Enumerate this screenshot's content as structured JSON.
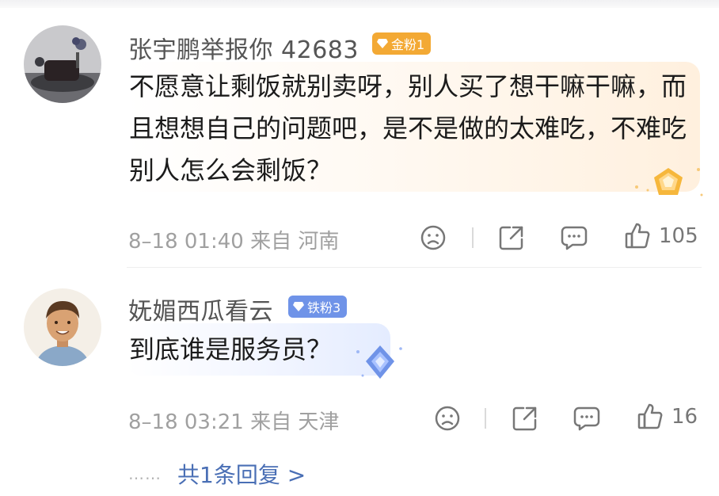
{
  "comments": [
    {
      "username": "张宇鹏举报你 42683",
      "badge": "金粉1",
      "text": "不愿意让剩饭就别卖呀，别人买了想干嘛干嘛，而且想想自己的问题吧，是不是做的太难吃，不难吃别人怎么会剩饭？",
      "meta": "8–18 01:40 来自 河南",
      "likes": "105"
    },
    {
      "username": "妩媚西瓜看云",
      "badge": "铁粉3",
      "text": "到底谁是服务员？",
      "meta": "8–18 03:21 来自 天津",
      "likes": "16"
    }
  ],
  "replies": {
    "dots": "……",
    "label": "共1条回复 >"
  },
  "colors": {
    "gold_badge": "#f3a934",
    "iron_badge": "#6f93e8",
    "reply_link": "#4a6fb5"
  },
  "icons": [
    "dislike-icon",
    "share-icon",
    "comment-icon",
    "like-icon",
    "gold-gem-icon",
    "blue-gem-icon"
  ]
}
